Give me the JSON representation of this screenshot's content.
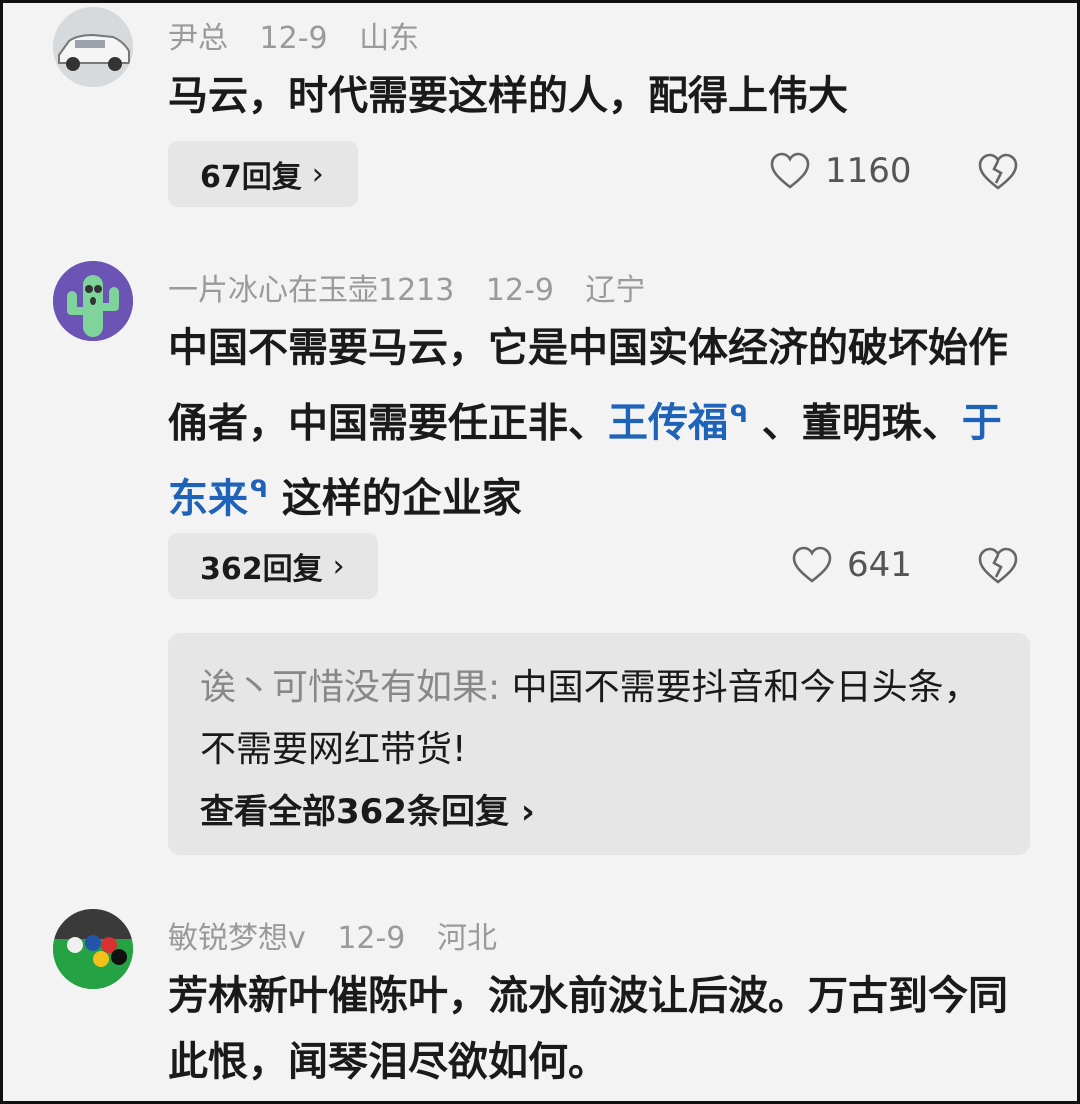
{
  "comments": [
    {
      "author": "尹总",
      "date": "12-9",
      "location": "山东",
      "text": "马云，时代需要这样的人，配得上伟大",
      "reply_label": "67回复",
      "likes": "1160",
      "avatar_icon": "car-avatar-icon"
    },
    {
      "author": "一片冰心在玉壶1213",
      "date": "12-9",
      "location": "辽宁",
      "text_part1": "中国不需要马云，它是中国实体经济的破坏始作俑者，中国需要任正非、",
      "link1": "王传福",
      "text_part2": "、董明珠、",
      "link2": "于东来",
      "text_part3": "这样的企业家",
      "reply_label": "362回复",
      "likes": "641",
      "avatar_icon": "cactus-avatar-icon",
      "sub_reply": {
        "author": "诶丶可惜没有如果:",
        "text": "中国不需要抖音和今日头条，不需要网红带货!",
        "view_all": "查看全部362条回复"
      }
    },
    {
      "author": "敏锐梦想v",
      "date": "12-9",
      "location": "河北",
      "text": "芳林新叶催陈叶，流水前波让后波。万古到今同此恨，闻琴泪尽欲如何。",
      "avatar_icon": "billiards-avatar-icon"
    }
  ],
  "search_icon_glyph": "ᑫ",
  "chevron_glyph": "›"
}
